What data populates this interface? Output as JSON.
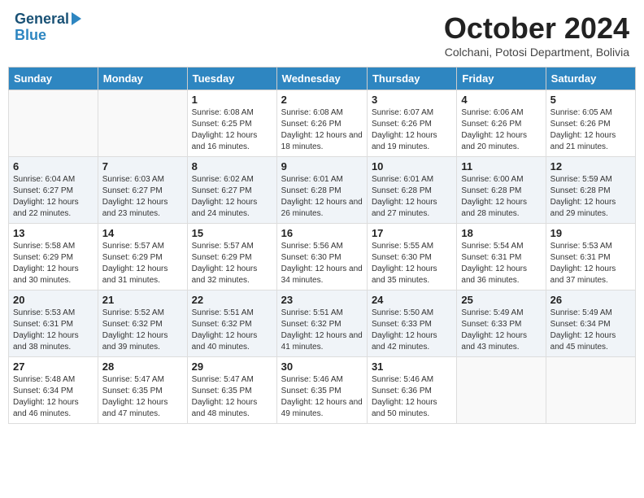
{
  "header": {
    "logo_line1": "General",
    "logo_line2": "Blue",
    "month_title": "October 2024",
    "subtitle": "Colchani, Potosi Department, Bolivia"
  },
  "days_of_week": [
    "Sunday",
    "Monday",
    "Tuesday",
    "Wednesday",
    "Thursday",
    "Friday",
    "Saturday"
  ],
  "weeks": [
    [
      {
        "day": "",
        "sunrise": "",
        "sunset": "",
        "daylight": ""
      },
      {
        "day": "",
        "sunrise": "",
        "sunset": "",
        "daylight": ""
      },
      {
        "day": "1",
        "sunrise": "Sunrise: 6:08 AM",
        "sunset": "Sunset: 6:25 PM",
        "daylight": "Daylight: 12 hours and 16 minutes."
      },
      {
        "day": "2",
        "sunrise": "Sunrise: 6:08 AM",
        "sunset": "Sunset: 6:26 PM",
        "daylight": "Daylight: 12 hours and 18 minutes."
      },
      {
        "day": "3",
        "sunrise": "Sunrise: 6:07 AM",
        "sunset": "Sunset: 6:26 PM",
        "daylight": "Daylight: 12 hours and 19 minutes."
      },
      {
        "day": "4",
        "sunrise": "Sunrise: 6:06 AM",
        "sunset": "Sunset: 6:26 PM",
        "daylight": "Daylight: 12 hours and 20 minutes."
      },
      {
        "day": "5",
        "sunrise": "Sunrise: 6:05 AM",
        "sunset": "Sunset: 6:26 PM",
        "daylight": "Daylight: 12 hours and 21 minutes."
      }
    ],
    [
      {
        "day": "6",
        "sunrise": "Sunrise: 6:04 AM",
        "sunset": "Sunset: 6:27 PM",
        "daylight": "Daylight: 12 hours and 22 minutes."
      },
      {
        "day": "7",
        "sunrise": "Sunrise: 6:03 AM",
        "sunset": "Sunset: 6:27 PM",
        "daylight": "Daylight: 12 hours and 23 minutes."
      },
      {
        "day": "8",
        "sunrise": "Sunrise: 6:02 AM",
        "sunset": "Sunset: 6:27 PM",
        "daylight": "Daylight: 12 hours and 24 minutes."
      },
      {
        "day": "9",
        "sunrise": "Sunrise: 6:01 AM",
        "sunset": "Sunset: 6:28 PM",
        "daylight": "Daylight: 12 hours and 26 minutes."
      },
      {
        "day": "10",
        "sunrise": "Sunrise: 6:01 AM",
        "sunset": "Sunset: 6:28 PM",
        "daylight": "Daylight: 12 hours and 27 minutes."
      },
      {
        "day": "11",
        "sunrise": "Sunrise: 6:00 AM",
        "sunset": "Sunset: 6:28 PM",
        "daylight": "Daylight: 12 hours and 28 minutes."
      },
      {
        "day": "12",
        "sunrise": "Sunrise: 5:59 AM",
        "sunset": "Sunset: 6:28 PM",
        "daylight": "Daylight: 12 hours and 29 minutes."
      }
    ],
    [
      {
        "day": "13",
        "sunrise": "Sunrise: 5:58 AM",
        "sunset": "Sunset: 6:29 PM",
        "daylight": "Daylight: 12 hours and 30 minutes."
      },
      {
        "day": "14",
        "sunrise": "Sunrise: 5:57 AM",
        "sunset": "Sunset: 6:29 PM",
        "daylight": "Daylight: 12 hours and 31 minutes."
      },
      {
        "day": "15",
        "sunrise": "Sunrise: 5:57 AM",
        "sunset": "Sunset: 6:29 PM",
        "daylight": "Daylight: 12 hours and 32 minutes."
      },
      {
        "day": "16",
        "sunrise": "Sunrise: 5:56 AM",
        "sunset": "Sunset: 6:30 PM",
        "daylight": "Daylight: 12 hours and 34 minutes."
      },
      {
        "day": "17",
        "sunrise": "Sunrise: 5:55 AM",
        "sunset": "Sunset: 6:30 PM",
        "daylight": "Daylight: 12 hours and 35 minutes."
      },
      {
        "day": "18",
        "sunrise": "Sunrise: 5:54 AM",
        "sunset": "Sunset: 6:31 PM",
        "daylight": "Daylight: 12 hours and 36 minutes."
      },
      {
        "day": "19",
        "sunrise": "Sunrise: 5:53 AM",
        "sunset": "Sunset: 6:31 PM",
        "daylight": "Daylight: 12 hours and 37 minutes."
      }
    ],
    [
      {
        "day": "20",
        "sunrise": "Sunrise: 5:53 AM",
        "sunset": "Sunset: 6:31 PM",
        "daylight": "Daylight: 12 hours and 38 minutes."
      },
      {
        "day": "21",
        "sunrise": "Sunrise: 5:52 AM",
        "sunset": "Sunset: 6:32 PM",
        "daylight": "Daylight: 12 hours and 39 minutes."
      },
      {
        "day": "22",
        "sunrise": "Sunrise: 5:51 AM",
        "sunset": "Sunset: 6:32 PM",
        "daylight": "Daylight: 12 hours and 40 minutes."
      },
      {
        "day": "23",
        "sunrise": "Sunrise: 5:51 AM",
        "sunset": "Sunset: 6:32 PM",
        "daylight": "Daylight: 12 hours and 41 minutes."
      },
      {
        "day": "24",
        "sunrise": "Sunrise: 5:50 AM",
        "sunset": "Sunset: 6:33 PM",
        "daylight": "Daylight: 12 hours and 42 minutes."
      },
      {
        "day": "25",
        "sunrise": "Sunrise: 5:49 AM",
        "sunset": "Sunset: 6:33 PM",
        "daylight": "Daylight: 12 hours and 43 minutes."
      },
      {
        "day": "26",
        "sunrise": "Sunrise: 5:49 AM",
        "sunset": "Sunset: 6:34 PM",
        "daylight": "Daylight: 12 hours and 45 minutes."
      }
    ],
    [
      {
        "day": "27",
        "sunrise": "Sunrise: 5:48 AM",
        "sunset": "Sunset: 6:34 PM",
        "daylight": "Daylight: 12 hours and 46 minutes."
      },
      {
        "day": "28",
        "sunrise": "Sunrise: 5:47 AM",
        "sunset": "Sunset: 6:35 PM",
        "daylight": "Daylight: 12 hours and 47 minutes."
      },
      {
        "day": "29",
        "sunrise": "Sunrise: 5:47 AM",
        "sunset": "Sunset: 6:35 PM",
        "daylight": "Daylight: 12 hours and 48 minutes."
      },
      {
        "day": "30",
        "sunrise": "Sunrise: 5:46 AM",
        "sunset": "Sunset: 6:35 PM",
        "daylight": "Daylight: 12 hours and 49 minutes."
      },
      {
        "day": "31",
        "sunrise": "Sunrise: 5:46 AM",
        "sunset": "Sunset: 6:36 PM",
        "daylight": "Daylight: 12 hours and 50 minutes."
      },
      {
        "day": "",
        "sunrise": "",
        "sunset": "",
        "daylight": ""
      },
      {
        "day": "",
        "sunrise": "",
        "sunset": "",
        "daylight": ""
      }
    ]
  ]
}
